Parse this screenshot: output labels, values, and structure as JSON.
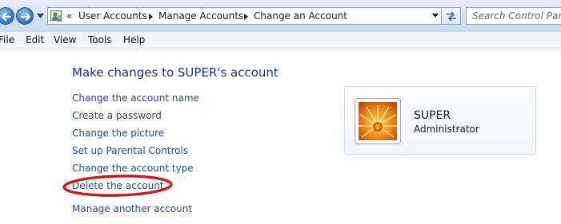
{
  "address_bar": {
    "overflow_chevron": "«",
    "breadcrumbs": [
      "User Accounts",
      "Manage Accounts",
      "Change an Account"
    ]
  },
  "search": {
    "placeholder": "Search Control Panel"
  },
  "menu": {
    "items": [
      "File",
      "Edit",
      "View",
      "Tools",
      "Help"
    ]
  },
  "page": {
    "title": "Make changes to SUPER's account",
    "links": [
      "Change the account name",
      "Create a password",
      "Change the picture",
      "Set up Parental Controls",
      "Change the account type",
      "Delete the account",
      "Manage another account"
    ]
  },
  "account": {
    "name": "SUPER",
    "role": "Administrator",
    "picture": "orange-flower"
  },
  "colors": {
    "link": "#1e4e9c",
    "title": "#1e3287",
    "highlight_ellipse": "#cc1a1a"
  },
  "icons": {
    "back": "back-arrow-icon",
    "forward": "forward-arrow-icon",
    "history": "chevron-down-icon",
    "location": "control-panel-users-icon",
    "refresh": "refresh-icon"
  }
}
